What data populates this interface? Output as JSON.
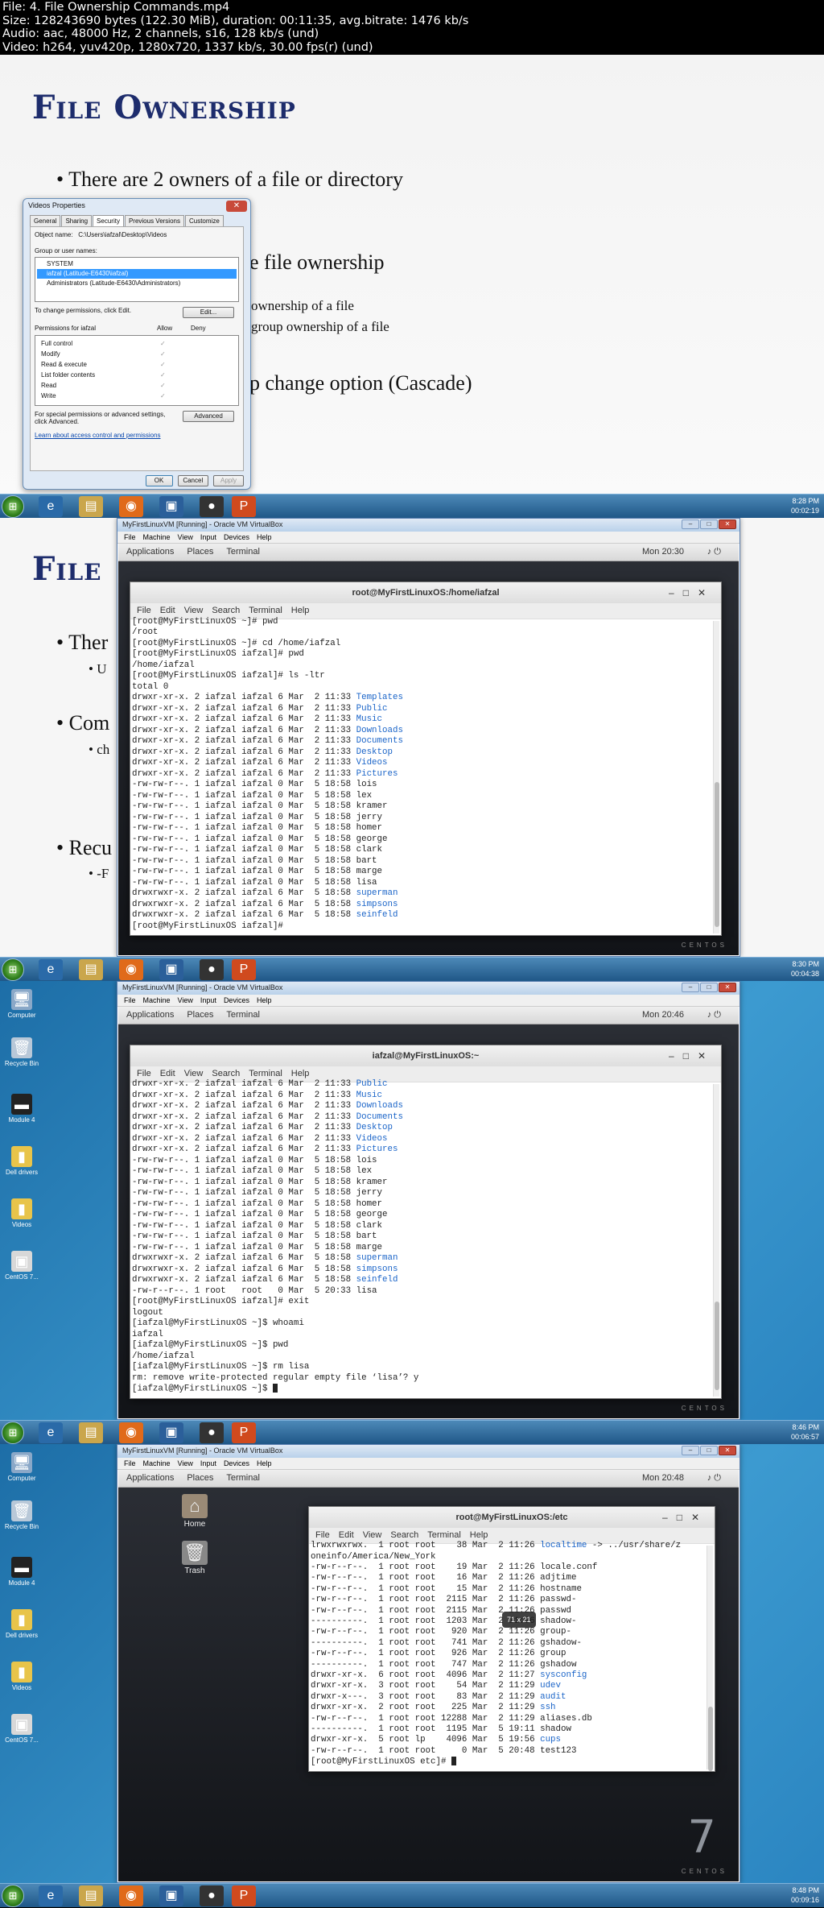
{
  "file_info": [
    "File: 4. File Ownership Commands.mp4",
    "Size: 128243690 bytes (122.30 MiB), duration: 00:11:35, avg.bitrate: 1476 kb/s",
    "Audio: aac, 48000 Hz, 2 channels, s16, 128 kb/s (und)",
    "Video: h264, yuv420p, 1280x720, 1337 kb/s, 30.00 fps(r) (und)"
  ],
  "slide": {
    "title": "File Ownership",
    "bullet1": "There are 2 owners of a file or directory",
    "bullet2_tail": "e file ownership",
    "sub1_tail": "ownership of a file",
    "sub2_tail": "group ownership of a file",
    "bullet3_tail": "p change option (Cascade)",
    "title_partial": "File",
    "b1_partial": "Ther",
    "b1_sub_partial": "U",
    "b2_partial": "Com",
    "b2_sub_partial": "ch",
    "b3_partial": "Recu",
    "b3_sub_partial": "-F"
  },
  "dialog": {
    "title": "Videos Properties",
    "tabs": [
      "General",
      "Sharing",
      "Security",
      "Previous Versions",
      "Customize"
    ],
    "object_label": "Object name:",
    "object_value": "C:\\Users\\iafzal\\Desktop\\Videos",
    "group_label": "Group or user names:",
    "users": [
      "SYSTEM",
      "iafzal (Latitude-E6430\\iafzal)",
      "Administrators (Latitude-E6430\\Administrators)"
    ],
    "change_text": "To change permissions, click Edit.",
    "edit_btn": "Edit...",
    "perm_label": "Permissions for iafzal",
    "allow": "Allow",
    "deny": "Deny",
    "perms": [
      "Full control",
      "Modify",
      "Read & execute",
      "List folder contents",
      "Read",
      "Write"
    ],
    "check": "✓",
    "special_text": "For special permissions or advanced settings, click Advanced.",
    "advanced_btn": "Advanced",
    "learn_link": "Learn about access control and permissions",
    "ok": "OK",
    "cancel": "Cancel",
    "apply": "Apply"
  },
  "vbox": {
    "title": "MyFirstLinuxVM [Running] - Oracle VM VirtualBox",
    "menu": [
      "File",
      "Machine",
      "View",
      "Input",
      "Devices",
      "Help"
    ],
    "guest_menu": [
      "Applications",
      "Places",
      "Terminal"
    ],
    "time1": "Mon 20:30",
    "time2": "Mon 20:46",
    "time3": "Mon 20:48"
  },
  "terminal_menu": [
    "File",
    "Edit",
    "View",
    "Search",
    "Terminal",
    "Help"
  ],
  "term1": {
    "title": "root@MyFirstLinuxOS:/home/iafzal",
    "lines": [
      {
        "t": "[root@MyFirstLinuxOS ~]# pwd"
      },
      {
        "t": "/root"
      },
      {
        "t": "[root@MyFirstLinuxOS ~]# cd /home/iafzal"
      },
      {
        "t": "[root@MyFirstLinuxOS iafzal]# pwd"
      },
      {
        "t": "/home/iafzal"
      },
      {
        "t": "[root@MyFirstLinuxOS iafzal]# ls -ltr"
      },
      {
        "t": "total 0"
      },
      {
        "t": "drwxr-xr-x. 2 iafzal iafzal 6 Mar  2 11:33 ",
        "d": "Templates"
      },
      {
        "t": "drwxr-xr-x. 2 iafzal iafzal 6 Mar  2 11:33 ",
        "d": "Public"
      },
      {
        "t": "drwxr-xr-x. 2 iafzal iafzal 6 Mar  2 11:33 ",
        "d": "Music"
      },
      {
        "t": "drwxr-xr-x. 2 iafzal iafzal 6 Mar  2 11:33 ",
        "d": "Downloads"
      },
      {
        "t": "drwxr-xr-x. 2 iafzal iafzal 6 Mar  2 11:33 ",
        "d": "Documents"
      },
      {
        "t": "drwxr-xr-x. 2 iafzal iafzal 6 Mar  2 11:33 ",
        "d": "Desktop"
      },
      {
        "t": "drwxr-xr-x. 2 iafzal iafzal 6 Mar  2 11:33 ",
        "d": "Videos"
      },
      {
        "t": "drwxr-xr-x. 2 iafzal iafzal 6 Mar  2 11:33 ",
        "d": "Pictures"
      },
      {
        "t": "-rw-rw-r--. 1 iafzal iafzal 0 Mar  5 18:58 lois"
      },
      {
        "t": "-rw-rw-r--. 1 iafzal iafzal 0 Mar  5 18:58 lex"
      },
      {
        "t": "-rw-rw-r--. 1 iafzal iafzal 0 Mar  5 18:58 kramer"
      },
      {
        "t": "-rw-rw-r--. 1 iafzal iafzal 0 Mar  5 18:58 jerry"
      },
      {
        "t": "-rw-rw-r--. 1 iafzal iafzal 0 Mar  5 18:58 homer"
      },
      {
        "t": "-rw-rw-r--. 1 iafzal iafzal 0 Mar  5 18:58 george"
      },
      {
        "t": "-rw-rw-r--. 1 iafzal iafzal 0 Mar  5 18:58 clark"
      },
      {
        "t": "-rw-rw-r--. 1 iafzal iafzal 0 Mar  5 18:58 bart"
      },
      {
        "t": "-rw-rw-r--. 1 iafzal iafzal 0 Mar  5 18:58 marge"
      },
      {
        "t": "-rw-rw-r--. 1 iafzal iafzal 0 Mar  5 18:58 lisa"
      },
      {
        "t": "drwxrwxr-x. 2 iafzal iafzal 6 Mar  5 18:58 ",
        "d": "superman"
      },
      {
        "t": "drwxrwxr-x. 2 iafzal iafzal 6 Mar  5 18:58 ",
        "d": "simpsons"
      },
      {
        "t": "drwxrwxr-x. 2 iafzal iafzal 6 Mar  5 18:58 ",
        "d": "seinfeld"
      },
      {
        "t": "[root@MyFirstLinuxOS iafzal]#"
      }
    ]
  },
  "term2": {
    "title": "iafzal@MyFirstLinuxOS:~",
    "lines": [
      {
        "t": "drwxr-xr-x. 2 iafzal iafzal 6 Mar  2 11:33 ",
        "d": "Public"
      },
      {
        "t": "drwxr-xr-x. 2 iafzal iafzal 6 Mar  2 11:33 ",
        "d": "Music"
      },
      {
        "t": "drwxr-xr-x. 2 iafzal iafzal 6 Mar  2 11:33 ",
        "d": "Downloads"
      },
      {
        "t": "drwxr-xr-x. 2 iafzal iafzal 6 Mar  2 11:33 ",
        "d": "Documents"
      },
      {
        "t": "drwxr-xr-x. 2 iafzal iafzal 6 Mar  2 11:33 ",
        "d": "Desktop"
      },
      {
        "t": "drwxr-xr-x. 2 iafzal iafzal 6 Mar  2 11:33 ",
        "d": "Videos"
      },
      {
        "t": "drwxr-xr-x. 2 iafzal iafzal 6 Mar  2 11:33 ",
        "d": "Pictures"
      },
      {
        "t": "-rw-rw-r--. 1 iafzal iafzal 0 Mar  5 18:58 lois"
      },
      {
        "t": "-rw-rw-r--. 1 iafzal iafzal 0 Mar  5 18:58 lex"
      },
      {
        "t": "-rw-rw-r--. 1 iafzal iafzal 0 Mar  5 18:58 kramer"
      },
      {
        "t": "-rw-rw-r--. 1 iafzal iafzal 0 Mar  5 18:58 jerry"
      },
      {
        "t": "-rw-rw-r--. 1 iafzal iafzal 0 Mar  5 18:58 homer"
      },
      {
        "t": "-rw-rw-r--. 1 iafzal iafzal 0 Mar  5 18:58 george"
      },
      {
        "t": "-rw-rw-r--. 1 iafzal iafzal 0 Mar  5 18:58 clark"
      },
      {
        "t": "-rw-rw-r--. 1 iafzal iafzal 0 Mar  5 18:58 bart"
      },
      {
        "t": "-rw-rw-r--. 1 iafzal iafzal 0 Mar  5 18:58 marge"
      },
      {
        "t": "drwxrwxr-x. 2 iafzal iafzal 6 Mar  5 18:58 ",
        "d": "superman"
      },
      {
        "t": "drwxrwxr-x. 2 iafzal iafzal 6 Mar  5 18:58 ",
        "d": "simpsons"
      },
      {
        "t": "drwxrwxr-x. 2 iafzal iafzal 6 Mar  5 18:58 ",
        "d": "seinfeld"
      },
      {
        "t": "-rw-r--r--. 1 root   root   0 Mar  5 20:33 lisa"
      },
      {
        "t": "[root@MyFirstLinuxOS iafzal]# exit"
      },
      {
        "t": "logout"
      },
      {
        "t": "[iafzal@MyFirstLinuxOS ~]$ whoami"
      },
      {
        "t": "iafzal"
      },
      {
        "t": "[iafzal@MyFirstLinuxOS ~]$ pwd"
      },
      {
        "t": "/home/iafzal"
      },
      {
        "t": "[iafzal@MyFirstLinuxOS ~]$ rm lisa"
      },
      {
        "t": "rm: remove write-protected regular empty file ‘lisa’? y"
      },
      {
        "t": "[iafzal@MyFirstLinuxOS ~]$ ",
        "c": true
      }
    ]
  },
  "term3": {
    "title": "root@MyFirstLinuxOS:/etc",
    "lines": [
      {
        "t": "lrwxrwxrwx.  1 root root    38 Mar  2 11:26 ",
        "d": "localtime",
        "a": " -> ../usr/share/z"
      },
      {
        "t": "oneinfo/America/New_York"
      },
      {
        "t": "-rw-r--r--.  1 root root    19 Mar  2 11:26 locale.conf"
      },
      {
        "t": "-rw-r--r--.  1 root root    16 Mar  2 11:26 adjtime"
      },
      {
        "t": "-rw-r--r--.  1 root root    15 Mar  2 11:26 hostname"
      },
      {
        "t": "-rw-r--r--.  1 root root  2115 Mar  2 11:26 passwd-"
      },
      {
        "t": "-rw-r--r--.  1 root root  2115 Mar  2 11:26 passwd"
      },
      {
        "t": "----------.  1 root root  1203 Mar  2 11:26 shadow-"
      },
      {
        "t": "-rw-r--r--.  1 root root   920 Mar  2 11:26 group-"
      },
      {
        "t": "----------.  1 root root   741 Mar  2 11:26 gshadow-"
      },
      {
        "t": "-rw-r--r--.  1 root root   926 Mar  2 11:26 group"
      },
      {
        "t": "----------.  1 root root   747 Mar  2 11:26 gshadow"
      },
      {
        "t": "drwxr-xr-x.  6 root root  4096 Mar  2 11:27 ",
        "d": "sysconfig"
      },
      {
        "t": "drwxr-xr-x.  3 root root    54 Mar  2 11:29 ",
        "d": "udev"
      },
      {
        "t": "drwxr-x---.  3 root root    83 Mar  2 11:29 ",
        "d": "audit"
      },
      {
        "t": "drwxr-xr-x.  2 root root   225 Mar  2 11:29 ",
        "d": "ssh"
      },
      {
        "t": "-rw-r--r--.  1 root root 12288 Mar  2 11:29 aliases.db"
      },
      {
        "t": "----------.  1 root root  1195 Mar  5 19:11 shadow"
      },
      {
        "t": "drwxr-xr-x.  5 root lp    4096 Mar  5 19:56 ",
        "d": "cups"
      },
      {
        "t": "-rw-r--r--.  1 root root     0 Mar  5 20:48 test123"
      },
      {
        "t": "[root@MyFirstLinuxOS etc]# ",
        "c": true
      }
    ],
    "tooltip": "71 x 21"
  },
  "desktop_icons": [
    "Computer",
    "Recycle Bin",
    "Module 4",
    "Dell drivers",
    "Videos",
    "CentOS 7..."
  ],
  "guest_icons": [
    "Home",
    "Trash"
  ],
  "centos_mark": "CENTOS",
  "centos_seven": "7",
  "tray_times": [
    "8:28 PM",
    "8:30 PM",
    "8:46 PM",
    "8:48 PM"
  ],
  "timestamps": [
    "00:02:19",
    "00:04:38",
    "00:06:57",
    "00:09:16"
  ],
  "colors": {
    "dir": "#1a64c8",
    "slide_title": "#1d2c6c"
  }
}
